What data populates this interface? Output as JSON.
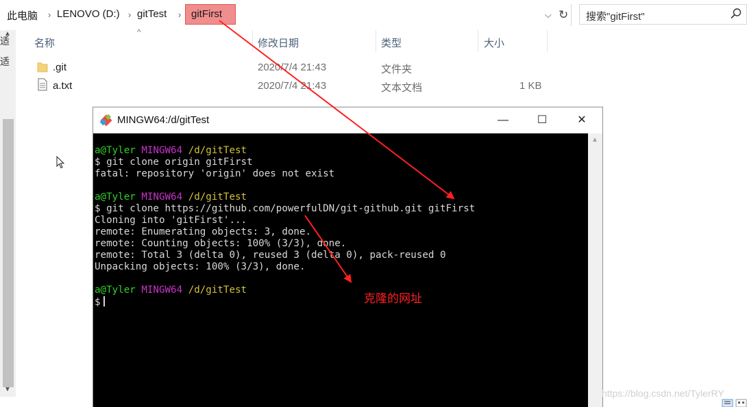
{
  "explorer": {
    "breadcrumb": [
      "此电脑",
      "LENOVO (D:)",
      "gitTest",
      "gitFirst"
    ],
    "search_placeholder": "搜索\"gitFirst\"",
    "nav_chars": [
      "适",
      "适"
    ],
    "columns": {
      "name": "名称",
      "modified": "修改日期",
      "type": "类型",
      "size": "大小"
    },
    "files": [
      {
        "name": ".git",
        "modified": "2020/7/4 21:43",
        "type": "文件夹",
        "size": "",
        "icon": "folder-icon"
      },
      {
        "name": "a.txt",
        "modified": "2020/7/4 21:43",
        "type": "文本文档",
        "size": "1 KB",
        "icon": "text-file-icon"
      }
    ]
  },
  "terminal": {
    "title": "MINGW64:/d/gitTest",
    "buttons": {
      "minimize": "—",
      "maximize": "☐",
      "close": "✕"
    },
    "prompt": {
      "user": "a@Tyler",
      "env": "MINGW64",
      "path": "/d/gitTest"
    },
    "lines": {
      "cmd1": "$ git clone origin gitFirst",
      "out1": "fatal: repository 'origin' does not exist",
      "cmd2": "$ git clone https://github.com/powerfulDN/git-github.git gitFirst",
      "out2": "Cloning into 'gitFirst'...",
      "out3": "remote: Enumerating objects: 3, done.",
      "out4": "remote: Counting objects: 100% (3/3), done.",
      "out5": "remote: Total 3 (delta 0), reused 3 (delta 0), pack-reused 0",
      "out6": "Unpacking objects: 100% (3/3), done.",
      "cmd3": "$"
    }
  },
  "annotation": {
    "label": "克隆的网址",
    "color": "#ff2020"
  },
  "watermark": "https://blog.csdn.net/TylerRY",
  "colors": {
    "highlight": "#f08d8d",
    "prompt_user": "#33d02a",
    "prompt_env": "#c833c8",
    "prompt_path": "#d2c33b",
    "terminal_bg": "#000000"
  }
}
